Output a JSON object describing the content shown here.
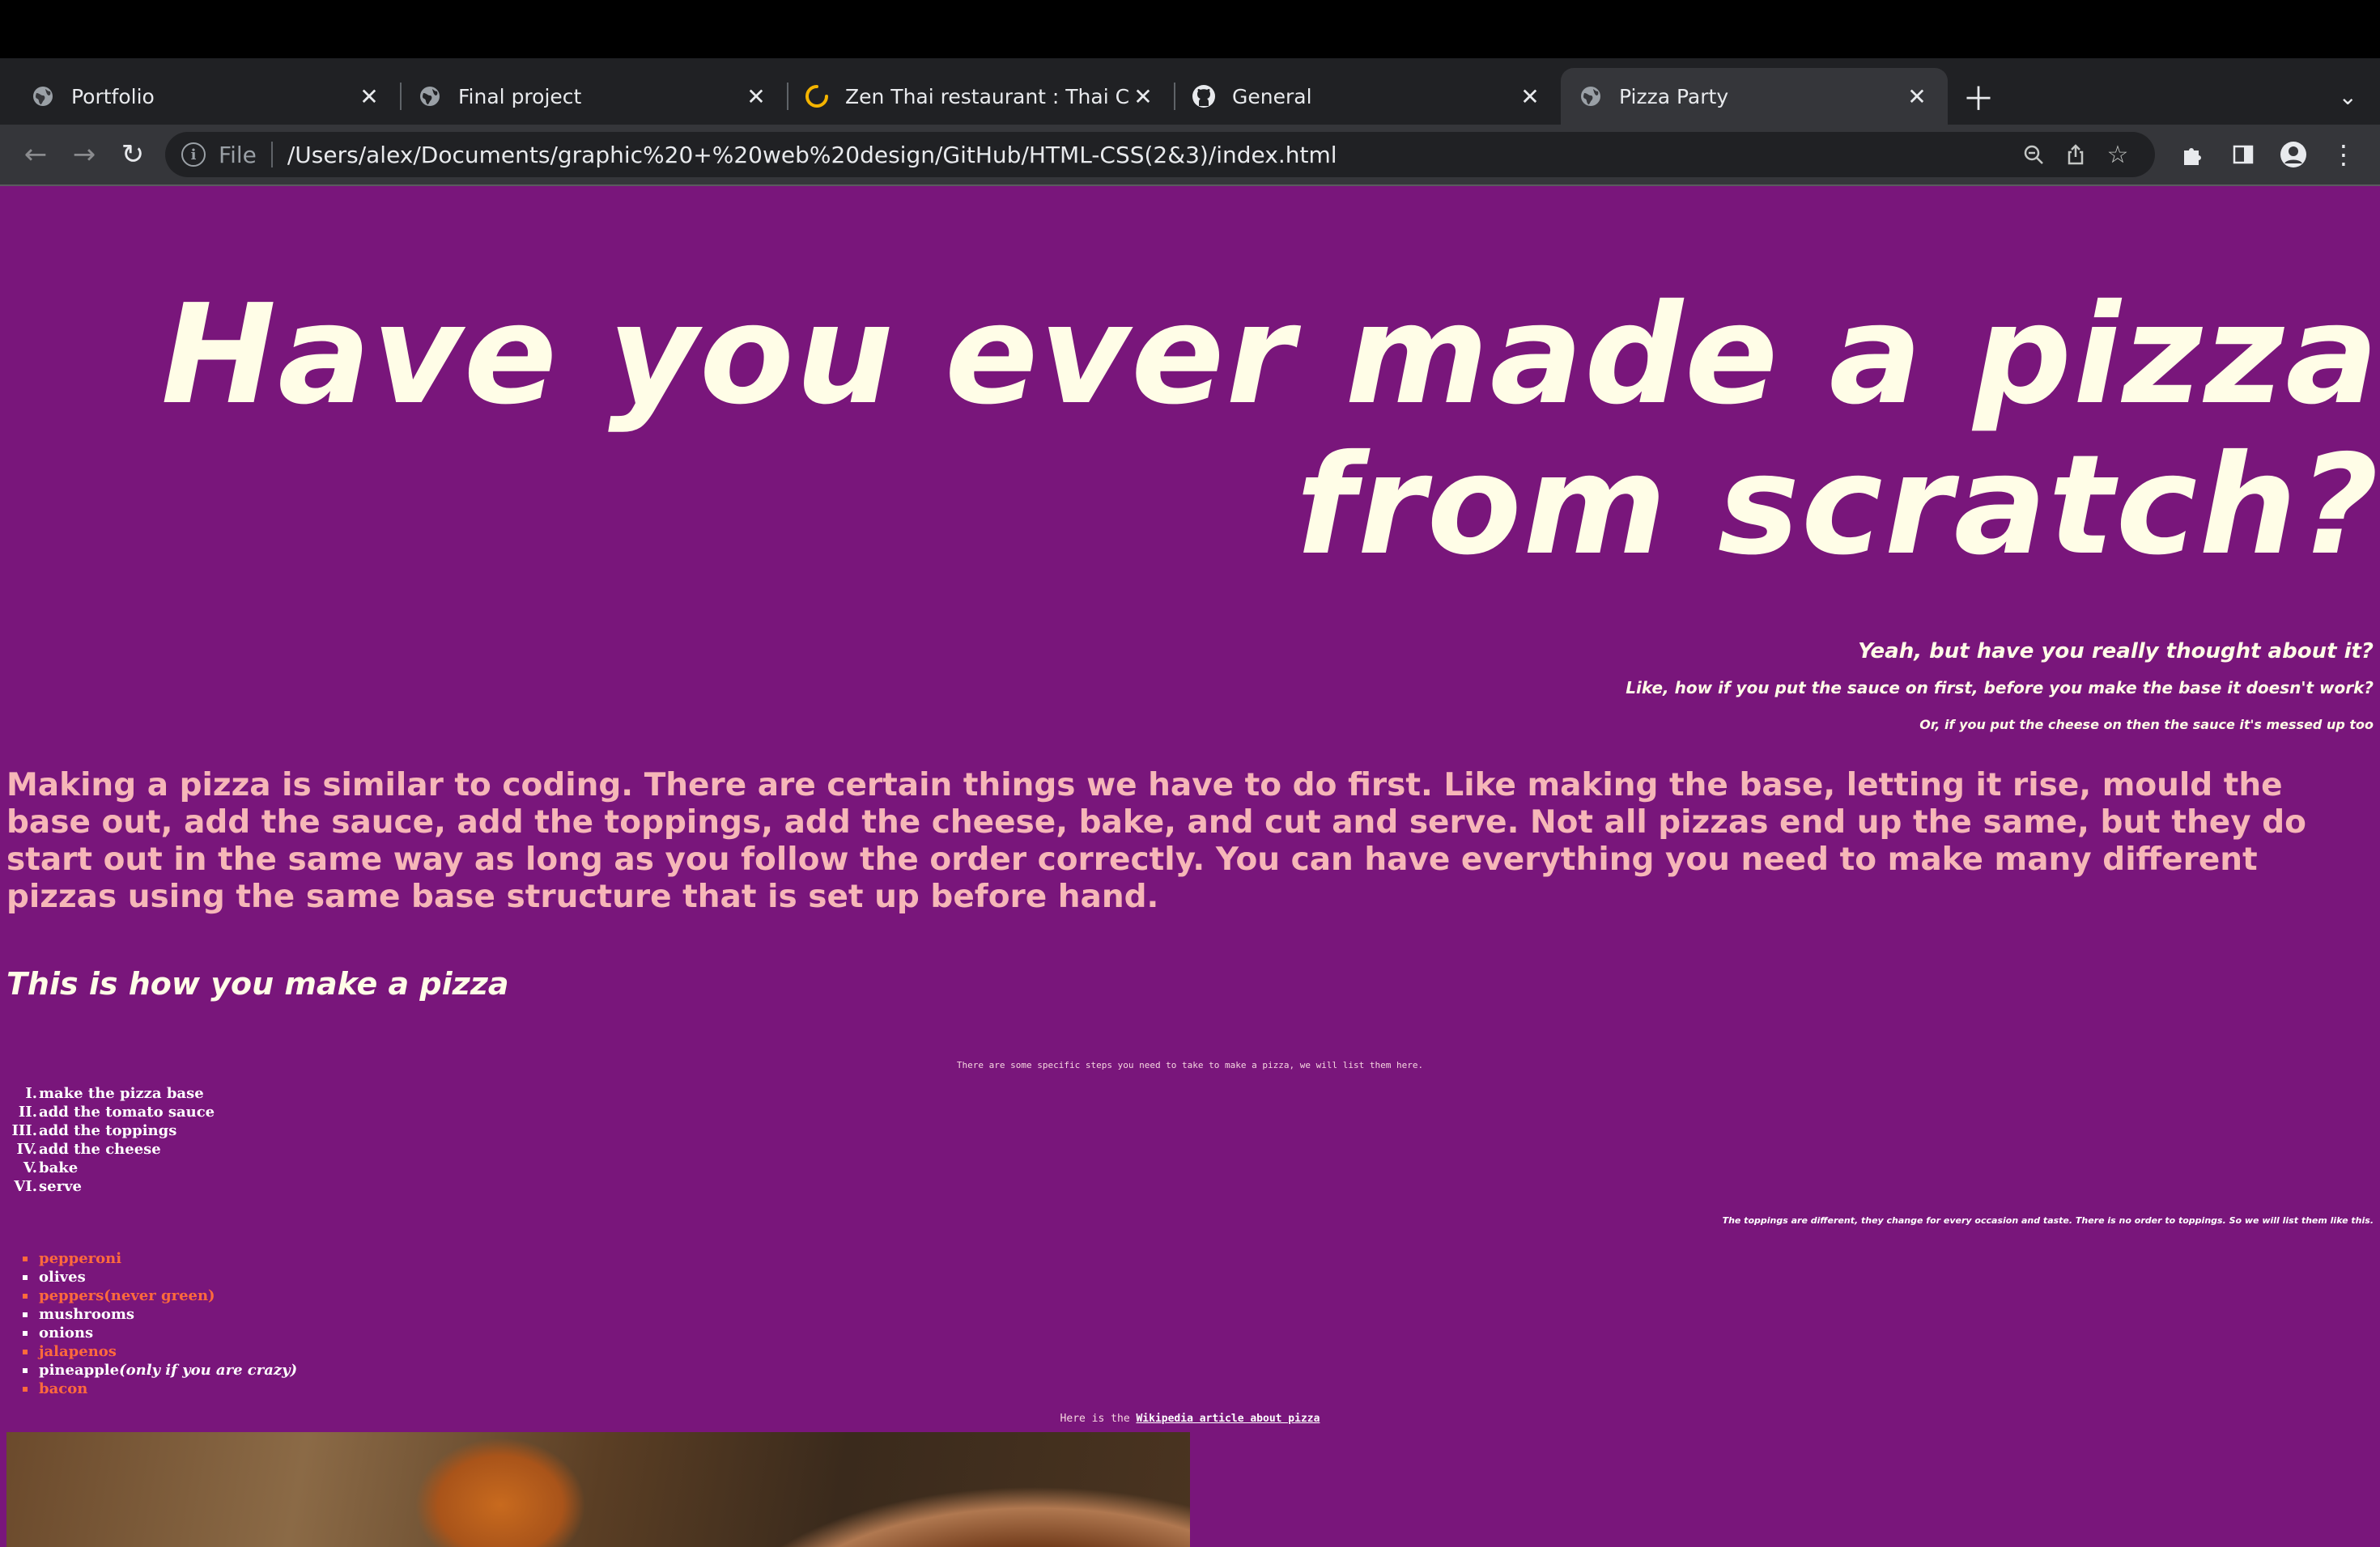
{
  "browser": {
    "tabs": [
      {
        "title": "Portfolio",
        "favicon": "globe-icon",
        "active": false
      },
      {
        "title": "Final project",
        "favicon": "globe-icon",
        "active": false
      },
      {
        "title": "Zen Thai restaurant : Thai Cuisine",
        "favicon": "loading-icon",
        "active": false
      },
      {
        "title": "General",
        "favicon": "github-icon",
        "active": false
      },
      {
        "title": "Pizza Party",
        "favicon": "globe-icon",
        "active": true
      }
    ],
    "omnibox": {
      "scheme_label": "File",
      "url": "/Users/alex/Documents/graphic%20+%20web%20design/GitHub/HTML-CSS(2&3)/index.html"
    }
  },
  "page": {
    "background_color": "#79167b",
    "heading": "Have you ever made a pizza from scratch?",
    "questions": [
      "Yeah, but have you really thought about it?",
      "Like, how if you put the sauce on first, before you make the base it doesn't work?",
      "Or, if you put the cheese on then the sauce it's messed up too"
    ],
    "paragraph": "Making a pizza is similar to coding. There are certain things we have to do first. Like making the base, letting it rise, mould the base out, add the sauce, add the toppings, add the cheese, bake, and cut and serve. Not all pizzas end up the same, but they do start out in the same way as long as you follow the order correctly. You can have everything you need to make many different pizzas using the same base structure that is set up before hand.",
    "howto_heading": "This is how you make a pizza",
    "steps_intro": "There are some specific steps you need to take to make a pizza, we will list them here.",
    "steps": [
      {
        "num": "I.",
        "text": "make the pizza base"
      },
      {
        "num": "II.",
        "text": "add the tomato sauce"
      },
      {
        "num": "III.",
        "text": "add the toppings"
      },
      {
        "num": "IV.",
        "text": "add the cheese"
      },
      {
        "num": "V.",
        "text": "bake"
      },
      {
        "num": "VI.",
        "text": "serve"
      }
    ],
    "toppings_intro": "The toppings are different, they change for every occasion and taste. There is no order to toppings. So we will list them like this.",
    "toppings": [
      {
        "text": "pepperoni",
        "note": ""
      },
      {
        "text": "olives",
        "note": ""
      },
      {
        "text": "peppers(never green)",
        "note": ""
      },
      {
        "text": "mushrooms",
        "note": ""
      },
      {
        "text": "onions",
        "note": ""
      },
      {
        "text": "jalapenos",
        "note": ""
      },
      {
        "text": "pineapple",
        "note": "(only if you are crazy)"
      },
      {
        "text": "bacon",
        "note": ""
      }
    ],
    "wiki_prefix": "Here is the ",
    "wiki_link": "Wikipedia article about pizza",
    "colors": {
      "heading": "#fffde7",
      "paragraph": "#f6b6b8",
      "topping_accent": "#ff6a3c"
    }
  }
}
